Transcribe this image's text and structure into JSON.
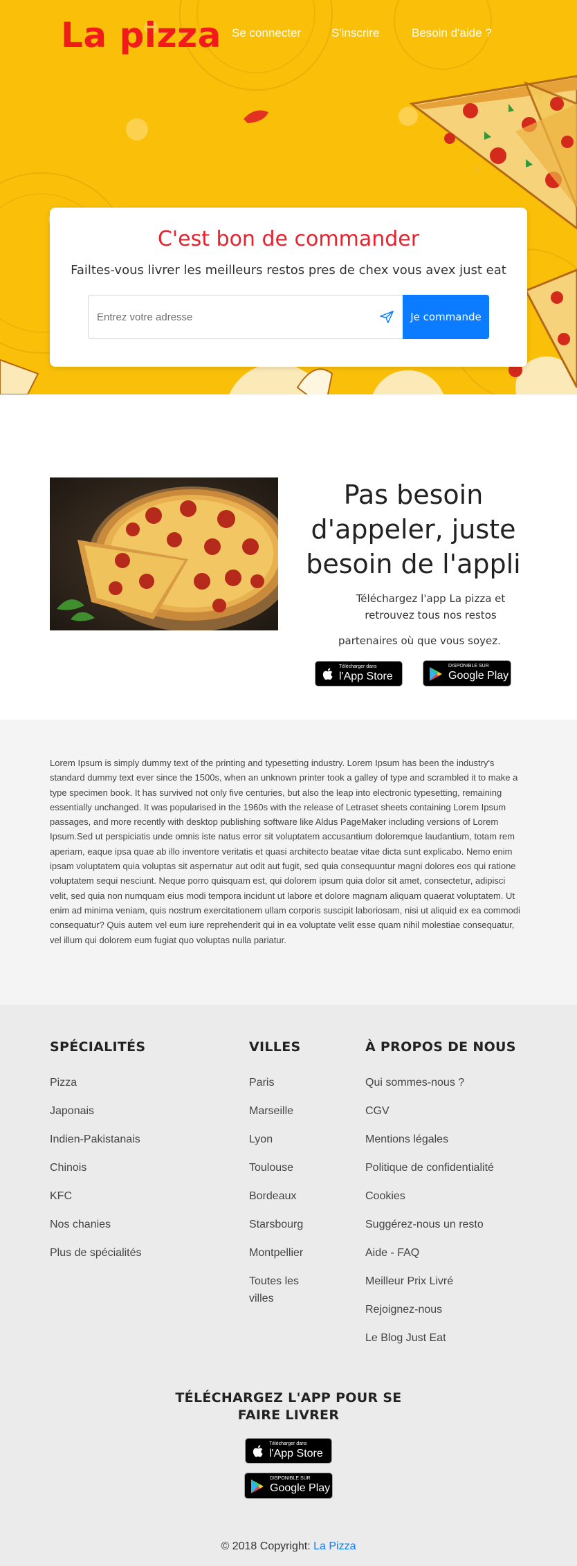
{
  "header": {
    "logo": "La pizza",
    "nav": [
      {
        "label": "Se connecter"
      },
      {
        "label": "S'inscrire"
      },
      {
        "label": "Besoin d'aide ?"
      }
    ]
  },
  "hero_card": {
    "title": "C'est bon de commander",
    "subtitle": "Failtes-vous livrer les meilleurs restos pres de chex vous avex just eat",
    "address_placeholder": "Entrez votre adresse",
    "address_value": "",
    "submit_label": "Je commande"
  },
  "promo": {
    "title": "Pas besoin d'appeler, juste besoin de l'appli",
    "text_line1": "Téléchargez l'app La pizza et retrouvez tous nos restos",
    "text_line2": "partenaires où que vous soyez.",
    "app_store": {
      "small": "Télécharger dans",
      "big": "l'App Store"
    },
    "google_play": {
      "small": "DISPONIBLE SUR",
      "big": "Google Play"
    }
  },
  "lorem": "Lorem Ipsum is simply dummy text of the printing and typesetting industry. Lorem Ipsum has been the industry's standard dummy text ever since the 1500s, when an unknown printer took a galley of type and scrambled it to make a type specimen book. It has survived not only five centuries, but also the leap into electronic typesetting, remaining essentially unchanged. It was popularised in the 1960s with the release of Letraset sheets containing Lorem Ipsum passages, and more recently with desktop publishing software like Aldus PageMaker including versions of Lorem Ipsum.Sed ut perspiciatis unde omnis iste natus error sit voluptatem accusantium doloremque laudantium, totam rem aperiam, eaque ipsa quae ab illo inventore veritatis et quasi architecto beatae vitae dicta sunt explicabo. Nemo enim ipsam voluptatem quia voluptas sit aspernatur aut odit aut fugit, sed quia consequuntur magni dolores eos qui ratione voluptatem sequi nesciunt. Neque porro quisquam est, qui dolorem ipsum quia dolor sit amet, consectetur, adipisci velit, sed quia non numquam eius modi tempora incidunt ut labore et dolore magnam aliquam quaerat voluptatem. Ut enim ad minima veniam, quis nostrum exercitationem ullam corporis suscipit laboriosam, nisi ut aliquid ex ea commodi consequatur? Quis autem vel eum iure reprehenderit qui in ea voluptate velit esse quam nihil molestiae consequatur, vel illum qui dolorem eum fugiat quo voluptas nulla pariatur.",
  "footer": {
    "specialites": {
      "title": "SPÉCIALITÉS",
      "items": [
        "Pizza",
        "Japonais",
        "Indien-Pakistanais",
        "Chinois",
        "KFC",
        "Nos chanies",
        "Plus de spécialités"
      ]
    },
    "villes": {
      "title": "VILLES",
      "items": [
        "Paris",
        "Marseille",
        "Lyon",
        "Toulouse",
        "Bordeaux",
        "Starsbourg",
        "Montpellier",
        "Toutes les villes"
      ]
    },
    "apropos": {
      "title": "À PROPOS DE NOUS",
      "items": [
        "Qui sommes-nous ?",
        "CGV",
        "Mentions légales",
        "Politique de confidentialité",
        "Cookies",
        "Suggérez-nous un resto",
        "Aide - FAQ",
        "Meilleur Prix Livré",
        "Rejoignez-nous",
        "Le Blog Just Eat"
      ]
    },
    "download_title_line1": "TÉLÉCHARGEZ L'APP POUR SE",
    "download_title_line2": "FAIRE LIVRER",
    "copyright_prefix": "© 2018 Copyright: ",
    "copyright_link": "La Pizza"
  },
  "colors": {
    "hero_bg": "#f9bf09",
    "logo_red": "#f21b1b",
    "accent_blue": "#0b7cff",
    "title_red": "#e8212c"
  }
}
